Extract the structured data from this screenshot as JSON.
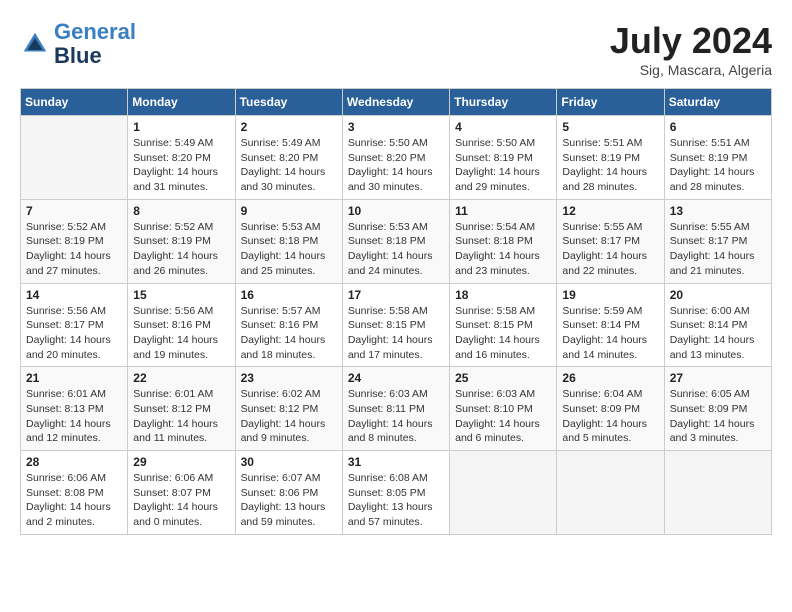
{
  "logo": {
    "line1": "General",
    "line2": "Blue"
  },
  "title": "July 2024",
  "subtitle": "Sig, Mascara, Algeria",
  "days_header": [
    "Sunday",
    "Monday",
    "Tuesday",
    "Wednesday",
    "Thursday",
    "Friday",
    "Saturday"
  ],
  "weeks": [
    [
      {
        "day": "",
        "info": ""
      },
      {
        "day": "1",
        "info": "Sunrise: 5:49 AM\nSunset: 8:20 PM\nDaylight: 14 hours\nand 31 minutes."
      },
      {
        "day": "2",
        "info": "Sunrise: 5:49 AM\nSunset: 8:20 PM\nDaylight: 14 hours\nand 30 minutes."
      },
      {
        "day": "3",
        "info": "Sunrise: 5:50 AM\nSunset: 8:20 PM\nDaylight: 14 hours\nand 30 minutes."
      },
      {
        "day": "4",
        "info": "Sunrise: 5:50 AM\nSunset: 8:19 PM\nDaylight: 14 hours\nand 29 minutes."
      },
      {
        "day": "5",
        "info": "Sunrise: 5:51 AM\nSunset: 8:19 PM\nDaylight: 14 hours\nand 28 minutes."
      },
      {
        "day": "6",
        "info": "Sunrise: 5:51 AM\nSunset: 8:19 PM\nDaylight: 14 hours\nand 28 minutes."
      }
    ],
    [
      {
        "day": "7",
        "info": "Sunrise: 5:52 AM\nSunset: 8:19 PM\nDaylight: 14 hours\nand 27 minutes."
      },
      {
        "day": "8",
        "info": "Sunrise: 5:52 AM\nSunset: 8:19 PM\nDaylight: 14 hours\nand 26 minutes."
      },
      {
        "day": "9",
        "info": "Sunrise: 5:53 AM\nSunset: 8:18 PM\nDaylight: 14 hours\nand 25 minutes."
      },
      {
        "day": "10",
        "info": "Sunrise: 5:53 AM\nSunset: 8:18 PM\nDaylight: 14 hours\nand 24 minutes."
      },
      {
        "day": "11",
        "info": "Sunrise: 5:54 AM\nSunset: 8:18 PM\nDaylight: 14 hours\nand 23 minutes."
      },
      {
        "day": "12",
        "info": "Sunrise: 5:55 AM\nSunset: 8:17 PM\nDaylight: 14 hours\nand 22 minutes."
      },
      {
        "day": "13",
        "info": "Sunrise: 5:55 AM\nSunset: 8:17 PM\nDaylight: 14 hours\nand 21 minutes."
      }
    ],
    [
      {
        "day": "14",
        "info": "Sunrise: 5:56 AM\nSunset: 8:17 PM\nDaylight: 14 hours\nand 20 minutes."
      },
      {
        "day": "15",
        "info": "Sunrise: 5:56 AM\nSunset: 8:16 PM\nDaylight: 14 hours\nand 19 minutes."
      },
      {
        "day": "16",
        "info": "Sunrise: 5:57 AM\nSunset: 8:16 PM\nDaylight: 14 hours\nand 18 minutes."
      },
      {
        "day": "17",
        "info": "Sunrise: 5:58 AM\nSunset: 8:15 PM\nDaylight: 14 hours\nand 17 minutes."
      },
      {
        "day": "18",
        "info": "Sunrise: 5:58 AM\nSunset: 8:15 PM\nDaylight: 14 hours\nand 16 minutes."
      },
      {
        "day": "19",
        "info": "Sunrise: 5:59 AM\nSunset: 8:14 PM\nDaylight: 14 hours\nand 14 minutes."
      },
      {
        "day": "20",
        "info": "Sunrise: 6:00 AM\nSunset: 8:14 PM\nDaylight: 14 hours\nand 13 minutes."
      }
    ],
    [
      {
        "day": "21",
        "info": "Sunrise: 6:01 AM\nSunset: 8:13 PM\nDaylight: 14 hours\nand 12 minutes."
      },
      {
        "day": "22",
        "info": "Sunrise: 6:01 AM\nSunset: 8:12 PM\nDaylight: 14 hours\nand 11 minutes."
      },
      {
        "day": "23",
        "info": "Sunrise: 6:02 AM\nSunset: 8:12 PM\nDaylight: 14 hours\nand 9 minutes."
      },
      {
        "day": "24",
        "info": "Sunrise: 6:03 AM\nSunset: 8:11 PM\nDaylight: 14 hours\nand 8 minutes."
      },
      {
        "day": "25",
        "info": "Sunrise: 6:03 AM\nSunset: 8:10 PM\nDaylight: 14 hours\nand 6 minutes."
      },
      {
        "day": "26",
        "info": "Sunrise: 6:04 AM\nSunset: 8:09 PM\nDaylight: 14 hours\nand 5 minutes."
      },
      {
        "day": "27",
        "info": "Sunrise: 6:05 AM\nSunset: 8:09 PM\nDaylight: 14 hours\nand 3 minutes."
      }
    ],
    [
      {
        "day": "28",
        "info": "Sunrise: 6:06 AM\nSunset: 8:08 PM\nDaylight: 14 hours\nand 2 minutes."
      },
      {
        "day": "29",
        "info": "Sunrise: 6:06 AM\nSunset: 8:07 PM\nDaylight: 14 hours\nand 0 minutes."
      },
      {
        "day": "30",
        "info": "Sunrise: 6:07 AM\nSunset: 8:06 PM\nDaylight: 13 hours\nand 59 minutes."
      },
      {
        "day": "31",
        "info": "Sunrise: 6:08 AM\nSunset: 8:05 PM\nDaylight: 13 hours\nand 57 minutes."
      },
      {
        "day": "",
        "info": ""
      },
      {
        "day": "",
        "info": ""
      },
      {
        "day": "",
        "info": ""
      }
    ]
  ]
}
